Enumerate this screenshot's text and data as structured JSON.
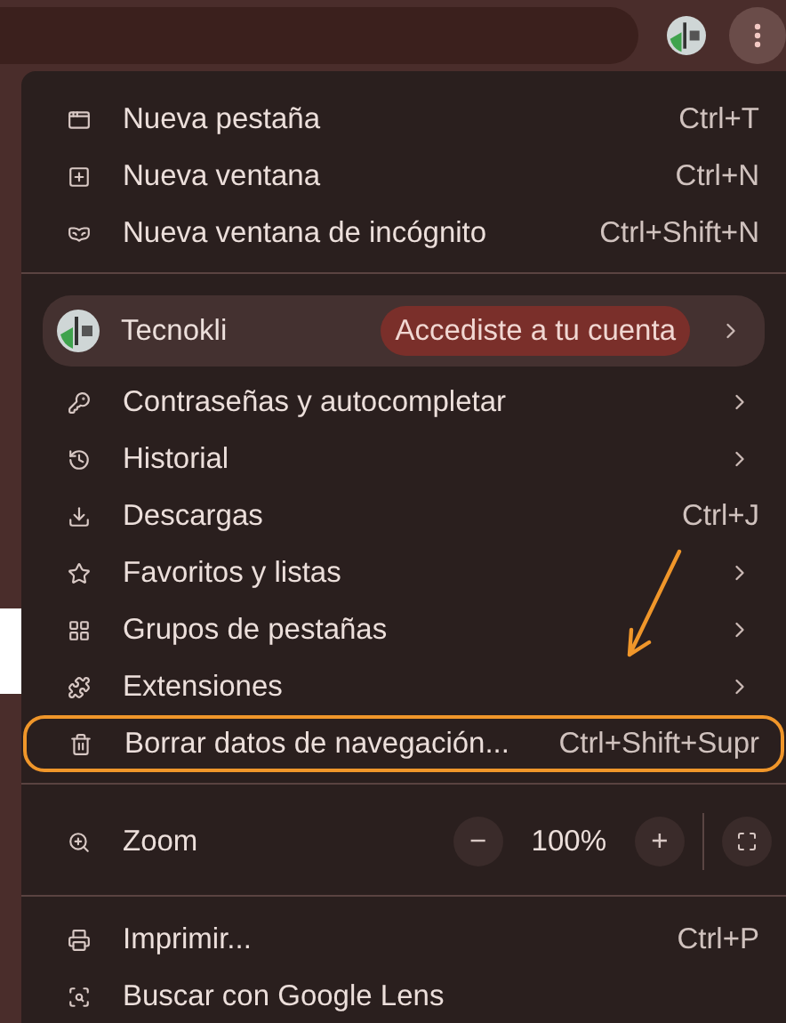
{
  "menu": {
    "sections": [
      [
        {
          "kind": "command",
          "label": "Nueva pestaña",
          "shortcut": "Ctrl+T",
          "has_submenu": false,
          "annotated": false
        },
        {
          "kind": "command",
          "label": "Nueva ventana",
          "shortcut": "Ctrl+N",
          "has_submenu": false,
          "annotated": false
        },
        {
          "kind": "command",
          "label": "Nueva ventana de incógnito",
          "shortcut": "Ctrl+Shift+N",
          "has_submenu": false,
          "annotated": false
        }
      ],
      [
        {
          "kind": "profile",
          "label": "Tecnokli",
          "badge": "Accediste a tu cuenta",
          "has_submenu": true
        },
        {
          "kind": "command",
          "label": "Contraseñas y autocompletar",
          "has_submenu": true,
          "annotated": false
        },
        {
          "kind": "command",
          "label": "Historial",
          "has_submenu": true,
          "annotated": false
        },
        {
          "kind": "command",
          "label": "Descargas",
          "shortcut": "Ctrl+J",
          "has_submenu": false,
          "annotated": false
        },
        {
          "kind": "command",
          "label": "Favoritos y listas",
          "has_submenu": true,
          "annotated": false
        },
        {
          "kind": "command",
          "label": "Grupos de pestañas",
          "has_submenu": true,
          "annotated": false
        },
        {
          "kind": "command",
          "label": "Extensiones",
          "has_submenu": true,
          "annotated": false
        },
        {
          "kind": "command",
          "label": "Borrar datos de navegación...",
          "shortcut": "Ctrl+Shift+Supr",
          "has_submenu": false,
          "annotated": true
        }
      ],
      [
        {
          "kind": "zoom",
          "label": "Zoom",
          "minus": "−",
          "value": "100%",
          "plus": "+"
        }
      ],
      [
        {
          "kind": "command",
          "label": "Imprimir...",
          "shortcut": "Ctrl+P",
          "has_submenu": false,
          "annotated": false
        },
        {
          "kind": "command",
          "label": "Buscar con Google Lens",
          "has_submenu": false,
          "annotated": false
        }
      ]
    ]
  }
}
